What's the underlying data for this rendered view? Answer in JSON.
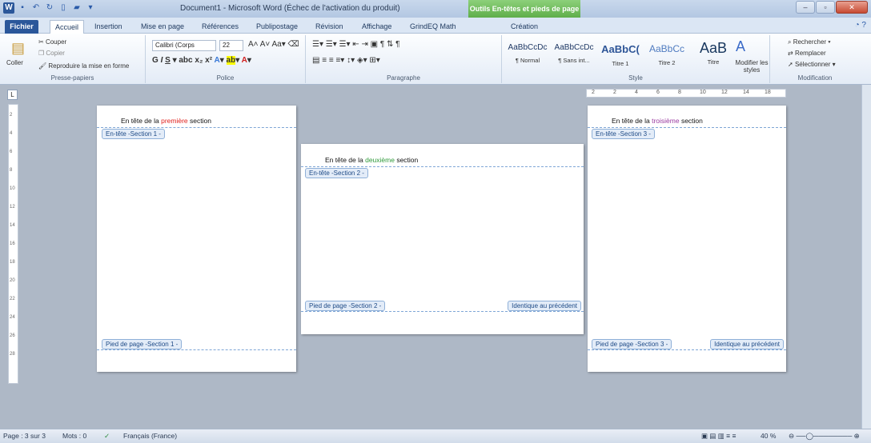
{
  "window": {
    "title": "Document1 - Microsoft Word (Échec de l'activation du produit)",
    "context_tab": "Outils En-têtes et pieds de page"
  },
  "tabs": [
    "Fichier",
    "Accueil",
    "Insertion",
    "Mise en page",
    "Références",
    "Publipostage",
    "Révision",
    "Affichage",
    "GrindEQ Math",
    "Création"
  ],
  "clipboard": {
    "couper": "Couper",
    "copier": "Copier",
    "coller": "Coller",
    "reproduire": "Reproduire la mise en forme",
    "label": "Presse-papiers"
  },
  "font": {
    "name": "Calibri (Corps",
    "size": "22",
    "label": "Police"
  },
  "paragraph": {
    "label": "Paragraphe"
  },
  "styles": {
    "items": [
      {
        "sample": "AaBbCcDc",
        "name": "¶ Normal"
      },
      {
        "sample": "AaBbCcDc",
        "name": "¶ Sans int..."
      },
      {
        "sample": "AaBbC(",
        "name": "Titre 1"
      },
      {
        "sample": "AaBbCc",
        "name": "Titre 2"
      },
      {
        "sample": "AaB",
        "name": "Titre"
      }
    ],
    "modifier": "Modifier les styles",
    "label": "Style"
  },
  "editing": {
    "rechercher": "Rechercher",
    "remplacer": "Remplacer",
    "selectionner": "Sélectionner",
    "label": "Modification"
  },
  "ruler": {
    "h_ticks": [
      "2",
      "2",
      "4",
      "6",
      "8",
      "10",
      "12",
      "14",
      "18"
    ],
    "v_ticks": [
      "2",
      "4",
      "6",
      "8",
      "10",
      "12",
      "14",
      "16",
      "18",
      "20",
      "22",
      "24",
      "26",
      "28"
    ]
  },
  "pages": [
    {
      "header_pre": "En tête de la ",
      "header_hl": "première",
      "header_post": " section",
      "header_tag": "En-tête -Section 1 -",
      "footer_tag": "Pied de page -Section 1 -"
    },
    {
      "header_pre": "En tête de la ",
      "header_hl": "deuxième",
      "header_post": " section",
      "header_tag": "En-tête -Section 2 -",
      "footer_tag": "Pied de page -Section 2 -",
      "same": "Identique au précédent"
    },
    {
      "header_pre": "En tête de la ",
      "header_hl": "troisième",
      "header_post": " section",
      "header_tag": "En-tête -Section 3 -",
      "footer_tag": "Pied de page -Section 3 -",
      "same": "Identique au précédent"
    }
  ],
  "status": {
    "page": "Page : 3 sur 3",
    "words": "Mots : 0",
    "lang": "Français (France)",
    "zoom": "40 %"
  }
}
